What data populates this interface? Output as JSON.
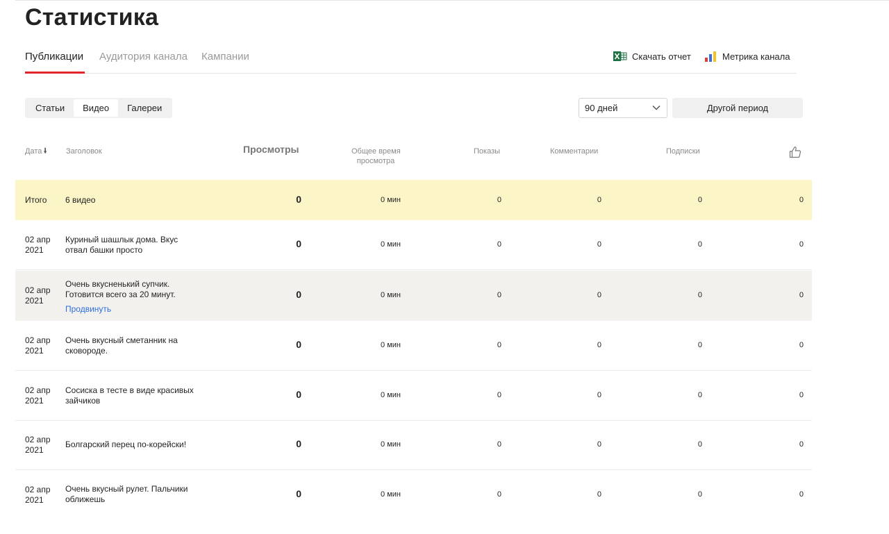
{
  "page_title": "Статистика",
  "tabs": [
    {
      "label": "Публикации",
      "active": true
    },
    {
      "label": "Аудитория канала",
      "active": false
    },
    {
      "label": "Кампании",
      "active": false
    }
  ],
  "actions": {
    "download_report": "Скачать отчет",
    "channel_metrika": "Метрика канала"
  },
  "content_type_tabs": [
    {
      "label": "Статьи",
      "active": false
    },
    {
      "label": "Видео",
      "active": true
    },
    {
      "label": "Галереи",
      "active": false
    }
  ],
  "period": {
    "selected": "90 дней",
    "other_period_label": "Другой период"
  },
  "table": {
    "columns": {
      "date": "Дата",
      "title": "Заголовок",
      "views": "Просмотры",
      "total_time_line1": "Общее время",
      "total_time_line2": "просмотра",
      "impressions": "Показы",
      "comments": "Комментарии",
      "subscriptions": "Подписки"
    },
    "total": {
      "label": "Итого",
      "title": "6 видео",
      "views": "0",
      "time": "0 мин",
      "impressions": "0",
      "comments": "0",
      "subscriptions": "0",
      "likes": "0"
    },
    "rows": [
      {
        "date_line1": "02 апр",
        "date_line2": "2021",
        "title_line1": "Куриный шашлык дома. Вкус",
        "title_line2": "отвал башки просто",
        "views": "0",
        "time": "0 мин",
        "impressions": "0",
        "comments": "0",
        "subscriptions": "0",
        "likes": "0"
      },
      {
        "date_line1": "02 апр",
        "date_line2": "2021",
        "title_line1": "Очень вкусненький супчик.",
        "title_line2": "Готовится всего за 20 минут.",
        "promote": "Продвинуть",
        "views": "0",
        "time": "0 мин",
        "impressions": "0",
        "comments": "0",
        "subscriptions": "0",
        "likes": "0"
      },
      {
        "date_line1": "02 апр",
        "date_line2": "2021",
        "title_line1": "Очень вкусный сметанник на",
        "title_line2": "сковороде.",
        "views": "0",
        "time": "0 мин",
        "impressions": "0",
        "comments": "0",
        "subscriptions": "0",
        "likes": "0"
      },
      {
        "date_line1": "02 апр",
        "date_line2": "2021",
        "title_line1": "Сосиска в тесте в виде красивых",
        "title_line2": "зайчиков",
        "views": "0",
        "time": "0 мин",
        "impressions": "0",
        "comments": "0",
        "subscriptions": "0",
        "likes": "0"
      },
      {
        "date_line1": "02 апр",
        "date_line2": "2021",
        "title_line1": "Болгарский перец по-корейски!",
        "title_line2": "",
        "views": "0",
        "time": "0 мин",
        "impressions": "0",
        "comments": "0",
        "subscriptions": "0",
        "likes": "0"
      },
      {
        "date_line1": "02 апр",
        "date_line2": "2021",
        "title_line1": "Очень вкусный рулет. Пальчики",
        "title_line2": "оближешь",
        "views": "0",
        "time": "0 мин",
        "impressions": "0",
        "comments": "0",
        "subscriptions": "0",
        "likes": "0"
      }
    ]
  },
  "colors": {
    "accent_red": "#e1232a",
    "total_row_bg": "#fcf5c7",
    "link_blue": "#2d6fdb",
    "excel_green": "#1e7145"
  },
  "icons": {
    "excel": "excel-icon",
    "metrika": "metrika-icon",
    "likes": "thumbs-up-icon",
    "dropdown": "chevron-down-icon",
    "sort": "arrow-down-icon"
  }
}
